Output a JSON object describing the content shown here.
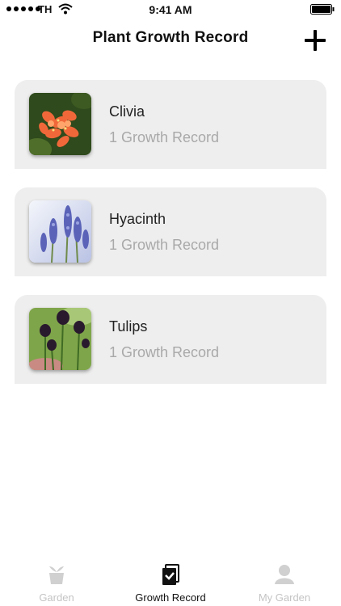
{
  "status_bar": {
    "carrier": "TH",
    "time": "9:41 AM"
  },
  "header": {
    "title": "Plant Growth Record"
  },
  "plants": [
    {
      "name": "Clivia",
      "records": "1 Growth Record",
      "icon": "clivia-photo"
    },
    {
      "name": "Hyacinth",
      "records": "1 Growth Record",
      "icon": "hyacinth-photo"
    },
    {
      "name": "Tulips",
      "records": "1 Growth Record",
      "icon": "tulips-photo"
    }
  ],
  "tab_bar": {
    "tabs": [
      {
        "label": "Garden",
        "icon": "potted-plant-icon",
        "active": false
      },
      {
        "label": "Growth Record",
        "icon": "record-book-icon",
        "active": true
      },
      {
        "label": "My Garden",
        "icon": "user-icon",
        "active": false
      }
    ]
  },
  "colors": {
    "card_background": "#eeeeee",
    "secondary_text": "#a9a9a9",
    "inactive_tab": "#c4c4c4"
  }
}
